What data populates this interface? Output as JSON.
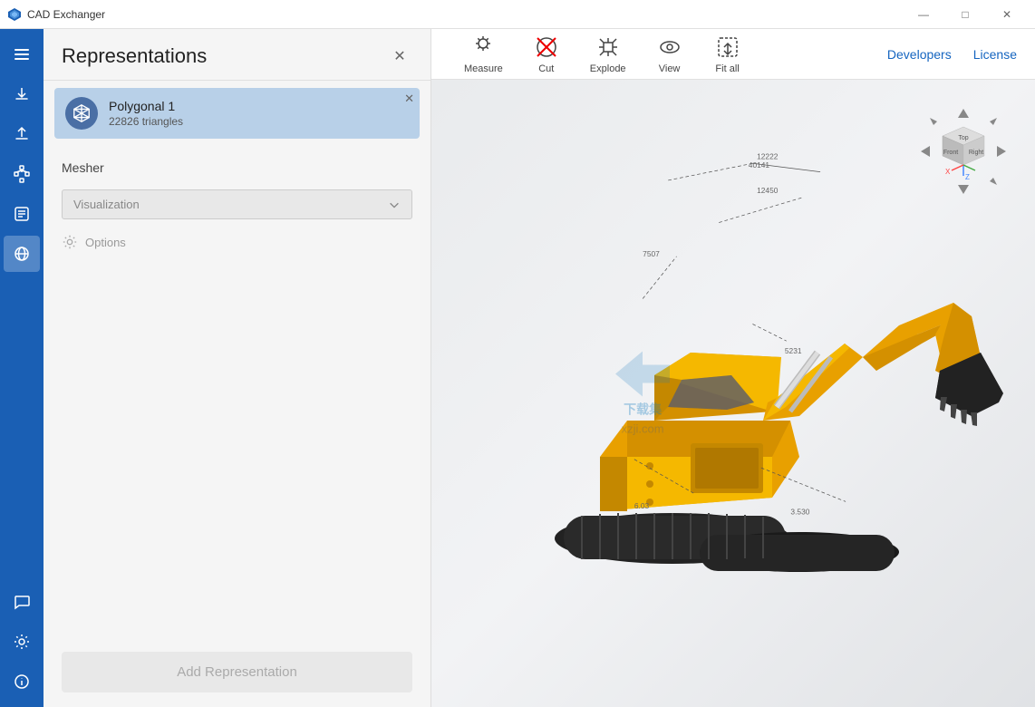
{
  "app": {
    "title": "CAD Exchanger",
    "logo": "cad-exchanger-logo"
  },
  "titlebar": {
    "title": "CAD Exchanger",
    "minimize_label": "—",
    "maximize_label": "□",
    "close_label": "✕"
  },
  "sidebar": {
    "items": [
      {
        "id": "menu",
        "icon": "menu-icon",
        "label": "Menu"
      },
      {
        "id": "import",
        "icon": "import-icon",
        "label": "Import"
      },
      {
        "id": "export",
        "icon": "export-icon",
        "label": "Export"
      },
      {
        "id": "structure",
        "icon": "structure-icon",
        "label": "Structure"
      },
      {
        "id": "properties",
        "icon": "properties-icon",
        "label": "Properties"
      },
      {
        "id": "globe",
        "icon": "globe-icon",
        "label": "Globe",
        "active": true
      }
    ],
    "bottom_items": [
      {
        "id": "chat",
        "icon": "chat-icon",
        "label": "Chat"
      },
      {
        "id": "settings",
        "icon": "settings-icon",
        "label": "Settings"
      },
      {
        "id": "info",
        "icon": "info-icon",
        "label": "Info"
      }
    ]
  },
  "panel": {
    "title": "Representations",
    "close_label": "✕",
    "representations": [
      {
        "name": "Polygonal 1",
        "sub": "22826 triangles",
        "icon": "polygon-icon"
      }
    ],
    "mesher": {
      "label": "Mesher",
      "dropdown_value": "Visualization",
      "dropdown_placeholder": "Visualization"
    },
    "options_label": "Options",
    "add_button_label": "Add Representation"
  },
  "toolbar": {
    "tools": [
      {
        "id": "measure",
        "label": "Measure",
        "icon": "measure-icon"
      },
      {
        "id": "cut",
        "label": "Cut",
        "icon": "cut-icon"
      },
      {
        "id": "explode",
        "label": "Explode",
        "icon": "explode-icon"
      },
      {
        "id": "view",
        "label": "View",
        "icon": "view-icon"
      },
      {
        "id": "fit-all",
        "label": "Fit all",
        "icon": "fit-all-icon"
      }
    ],
    "links": [
      {
        "id": "developers",
        "label": "Developers"
      },
      {
        "id": "license",
        "label": "License"
      }
    ]
  },
  "nav_cube": {
    "faces": [
      "Top",
      "Front",
      "Right"
    ],
    "arrows": true
  },
  "colors": {
    "accent_blue": "#1a5fb4",
    "panel_bg": "#f5f5f5",
    "selection_bg": "#b8d0e8",
    "toolbar_bg": "#ffffff",
    "viewport_bg": "#e8eaec"
  }
}
